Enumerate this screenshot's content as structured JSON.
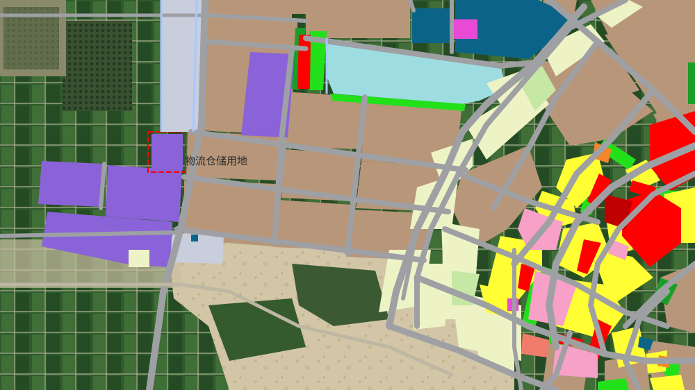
{
  "map": {
    "label_text": "物流仓储用地",
    "legend_colors": {
      "industrial_land": "#b8967a",
      "logistics_warehouse": "#8a63d8",
      "water": "#9ddde2",
      "green_space": "#22e01a",
      "residential": "#ffff33",
      "commercial": "#ff0000",
      "public_service": "#f7a0c8",
      "utilities": "#0b6488",
      "road": "#9ea0a4",
      "vacant_land": "#eef3c6",
      "farmland_imagery": "#2f5a2b"
    }
  }
}
